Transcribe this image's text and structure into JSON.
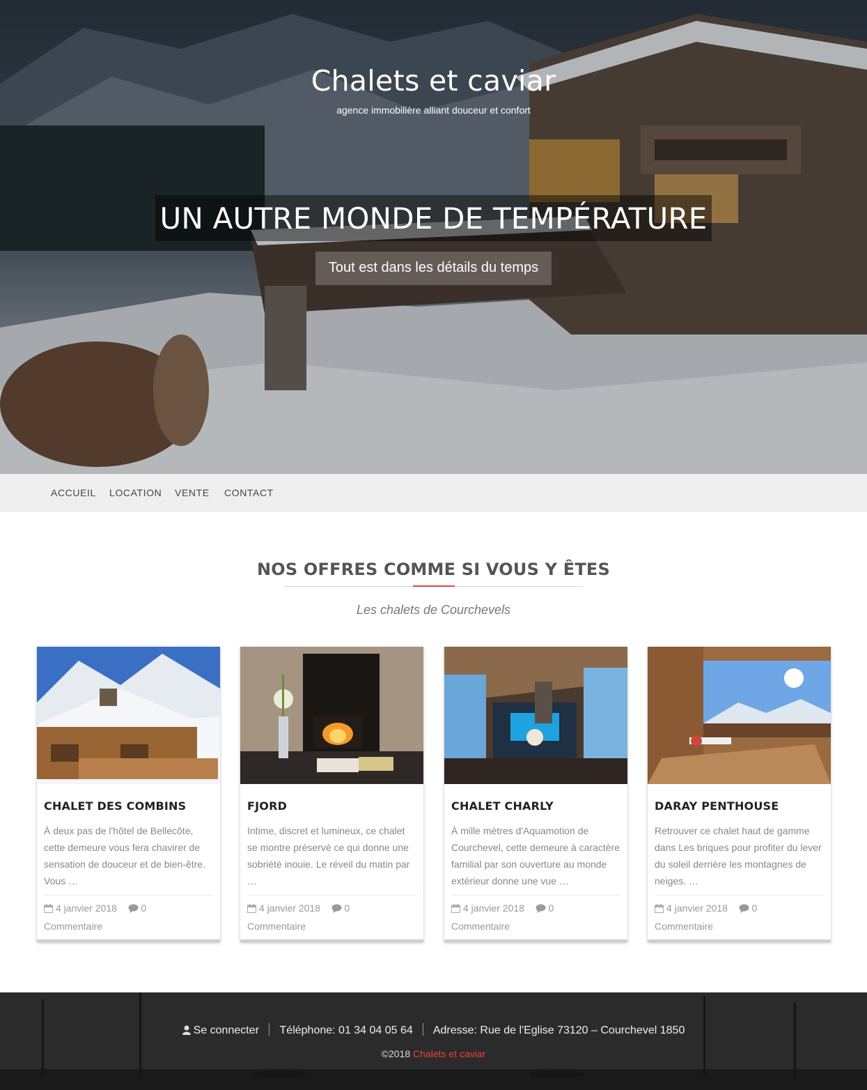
{
  "site": {
    "title": "Chalets et caviar",
    "tagline": "agence immobilière alliant douceur et confort"
  },
  "hero": {
    "heading": "UN AUTRE MONDE DE TEMPÉRATURE",
    "subheading": "Tout est dans les détails du temps"
  },
  "nav": {
    "items": [
      {
        "label": "ACCUEIL"
      },
      {
        "label": "LOCATION"
      },
      {
        "label": "VENTE"
      },
      {
        "label": "CONTACT"
      }
    ]
  },
  "offers": {
    "title": "NOS OFFRES COMME SI VOUS Y ÊTES",
    "subtitle": "Les chalets de Courchevels",
    "cards": [
      {
        "title": "CHALET DES COMBINS",
        "excerpt": "À deux pas de l'hôtel de Bellecôte, cette demeure vous fera chavirer de sensation de douceur et de bien-être. Vous …",
        "date": "4 janvier 2018",
        "comments": "0",
        "comments_label": "Commentaire"
      },
      {
        "title": "FJORD",
        "excerpt": "Intime, discret et lumineux, ce chalet se montre préservé ce qui donne une sobriété inouie. Le réveil du matin par …",
        "date": "4 janvier 2018",
        "comments": "0",
        "comments_label": "Commentaire"
      },
      {
        "title": "CHALET CHARLY",
        "excerpt": "À mille mètres d'Aquamotion de Courchevel, cette demeure à caractère familial par son ouverture au monde extérieur donne une vue …",
        "date": "4 janvier 2018",
        "comments": "0",
        "comments_label": "Commentaire"
      },
      {
        "title": "DARAY PENTHOUSE",
        "excerpt": "Retrouver ce chalet haut de gamme dans Les briques pour profiter du lever du soleil derrière les montagnes de neiges. …",
        "date": "4 janvier 2018",
        "comments": "0",
        "comments_label": "Commentaire"
      }
    ]
  },
  "footer": {
    "login": "Se connecter",
    "phone": "Téléphone: 01 34 04 05 64",
    "address": "Adresse: Rue de l'Eglise 73120 – Courchevel 1850",
    "copyright": "©2018",
    "brand": "Chalets et caviar"
  },
  "colors": {
    "accent": "#e7423a",
    "nav_bg": "#efefef",
    "footer_bg": "#2a2a2a"
  },
  "icons": {
    "date": "calendar-icon",
    "comments": "comment-icon",
    "login": "user-icon"
  }
}
